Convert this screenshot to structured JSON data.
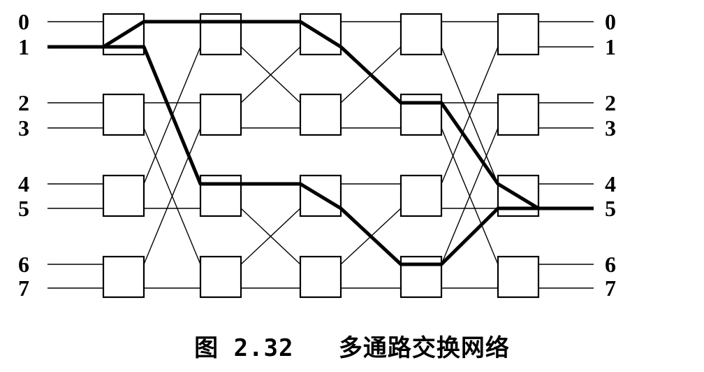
{
  "inputs": [
    "0",
    "1",
    "2",
    "3",
    "4",
    "5",
    "6",
    "7"
  ],
  "outputs": [
    "0",
    "1",
    "2",
    "3",
    "4",
    "5",
    "6",
    "7"
  ],
  "stages": 5,
  "switches_per_stage": 4,
  "highlighted_path": {
    "from_input": "1",
    "to_output": "5"
  },
  "caption": {
    "figure_number": "图 2.32",
    "title": "多通路交换网络"
  },
  "colors": {
    "line": "#000000",
    "background": "#ffffff"
  }
}
